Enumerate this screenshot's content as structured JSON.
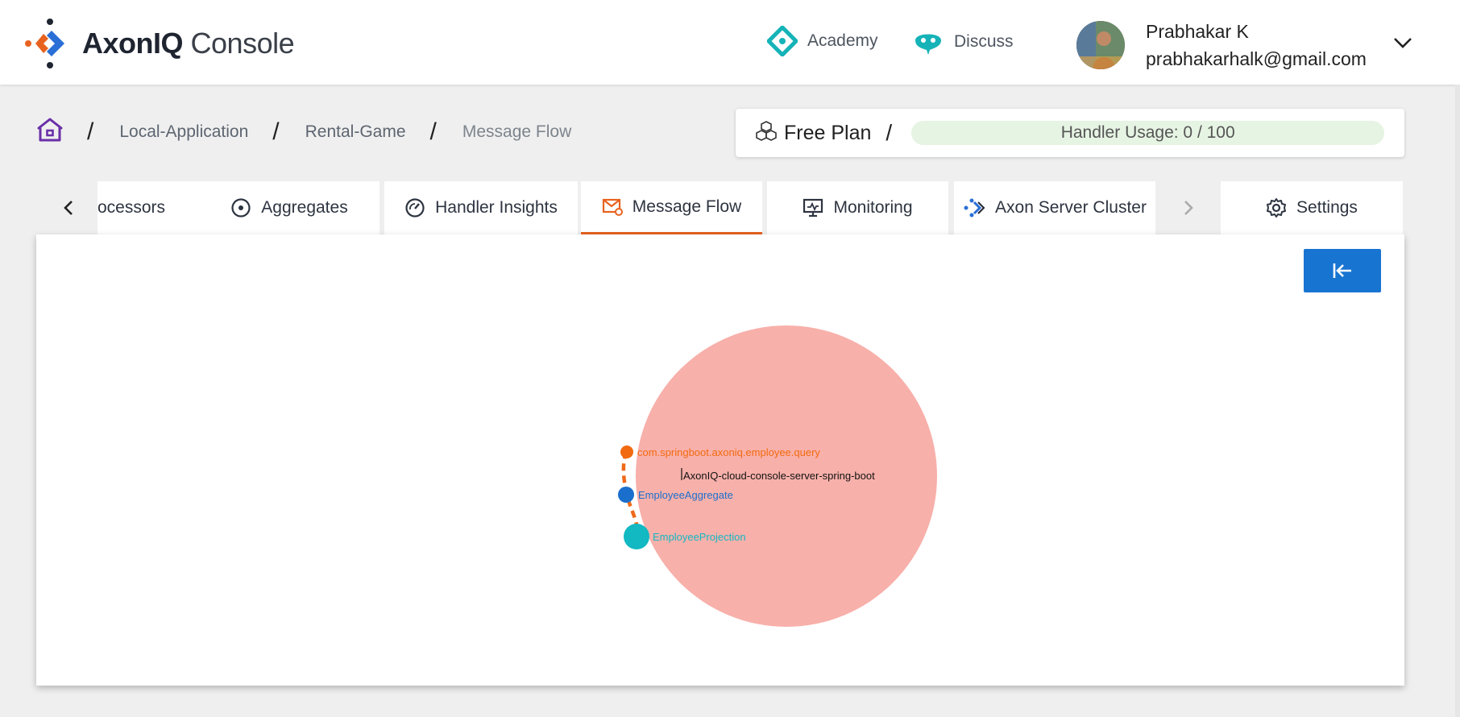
{
  "brand": {
    "name_bold": "AxonIQ",
    "name_light": "Console"
  },
  "header": {
    "links": {
      "academy": "Academy",
      "discuss": "Discuss"
    },
    "user": {
      "name": "Prabhakar K",
      "email": "prabhakarhalk@gmail.com"
    }
  },
  "breadcrumb": {
    "items": [
      "Local-Application",
      "Rental-Game",
      "Message Flow"
    ]
  },
  "plan": {
    "name": "Free Plan",
    "usage_label": "Handler Usage: 0 / 100",
    "usage_used": 0,
    "usage_limit": 100
  },
  "tabs": {
    "items": [
      "ocessors",
      "Aggregates",
      "Handler Insights",
      "Message Flow",
      "Monitoring",
      "Axon Server Cluster",
      "Settings"
    ],
    "active": "Message Flow"
  },
  "graph": {
    "app_label": "AxonIQ-cloud-console-server-spring-boot",
    "nodes": [
      {
        "label": "com.springboot.axoniq.employee.query",
        "color": "#f26a10"
      },
      {
        "label": "EmployeeAggregate",
        "color": "#1b6fcc"
      },
      {
        "label": "EmployeeProjection",
        "color": "#12b8c2"
      }
    ],
    "app_color": "#f8b0aa",
    "edge_color": "#ef6a1a"
  },
  "colors": {
    "accent": "#e8621f",
    "primary": "#1874d1",
    "usage_bg": "#e6f4e3"
  }
}
